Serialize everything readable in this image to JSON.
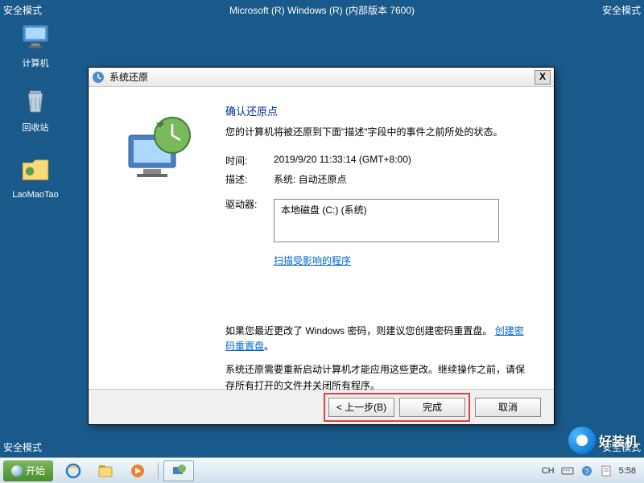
{
  "safe_mode_label": "安全模式",
  "desktop_title": "Microsoft (R) Windows (R) (内部版本 7600)",
  "desktop_icons": {
    "computer": "计算机",
    "recycle": "回收站",
    "folder": "LaoMaoTao"
  },
  "dialog": {
    "title": "系统还原",
    "close": "X",
    "heading": "确认还原点",
    "description": "您的计算机将被还原到下面\"描述\"字段中的事件之前所处的状态。",
    "time_label": "时间:",
    "time_value": "2019/9/20 11:33:14 (GMT+8:00)",
    "desc_label": "描述:",
    "desc_value": "系统: 自动还原点",
    "drives_label": "驱动器:",
    "drives_value": "本地磁盘 (C:) (系统)",
    "scan_link": "扫描受影响的程序",
    "password_text1": "如果您最近更改了 Windows 密码，则建议您创建密码重置盘。",
    "password_link": "创建密码重置盘",
    "restart_text": "系统还原需要重新启动计算机才能应用这些更改。继续操作之前，请保存所有打开的文件并关闭所有程序。",
    "back_btn": "< 上一步(B)",
    "finish_btn": "完成",
    "cancel_btn": "取消"
  },
  "taskbar": {
    "start": "开始",
    "lang": "CH",
    "time": "5:58"
  },
  "watermark": "好装机"
}
